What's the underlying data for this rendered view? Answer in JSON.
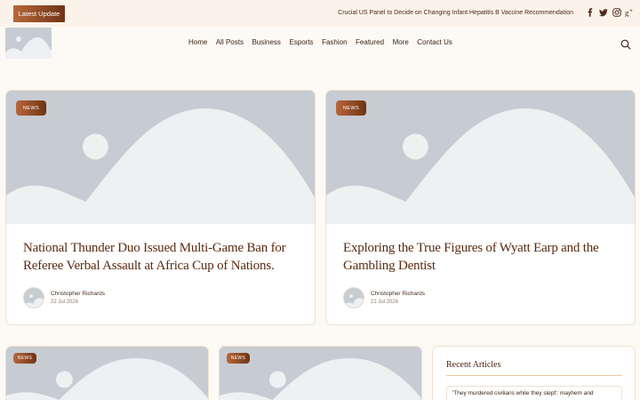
{
  "topbar": {
    "latest_label": "Latest Update",
    "ticker_text": "Crucial US Panel to Decide on Changing Infant Hepatitis B Vaccine Recommendation",
    "social_icons": [
      "facebook-icon",
      "twitter-icon",
      "instagram-icon",
      "google-plus-icon"
    ]
  },
  "nav": {
    "items": [
      "Home",
      "All Posts",
      "Business",
      "Esports",
      "Fashion",
      "Featured",
      "More",
      "Contact Us"
    ]
  },
  "colors": {
    "accent": "#8a4220",
    "title": "#5a2a10",
    "placeholder": "#c6ccd2",
    "background": "#fdfaf6"
  },
  "cards": [
    {
      "tag": "NEWS",
      "title": "National Thunder Duo Issued Multi-Game Ban for Referee Verbal Assault at Africa Cup of Nations.",
      "author": "Christopher Richards",
      "date": "22 Jul 2026"
    },
    {
      "tag": "NEWS",
      "title": "Exploring the True Figures of Wyatt Earp and the Gambling Dentist",
      "author": "Christopher Richards",
      "date": "21 Jul 2026"
    },
    {
      "tag": "NEWS"
    },
    {
      "tag": "NEWS"
    }
  ],
  "sidebar": {
    "heading": "Recent Articles",
    "items": [
      "'They murdered civilians while they slept': mayhem and"
    ]
  }
}
